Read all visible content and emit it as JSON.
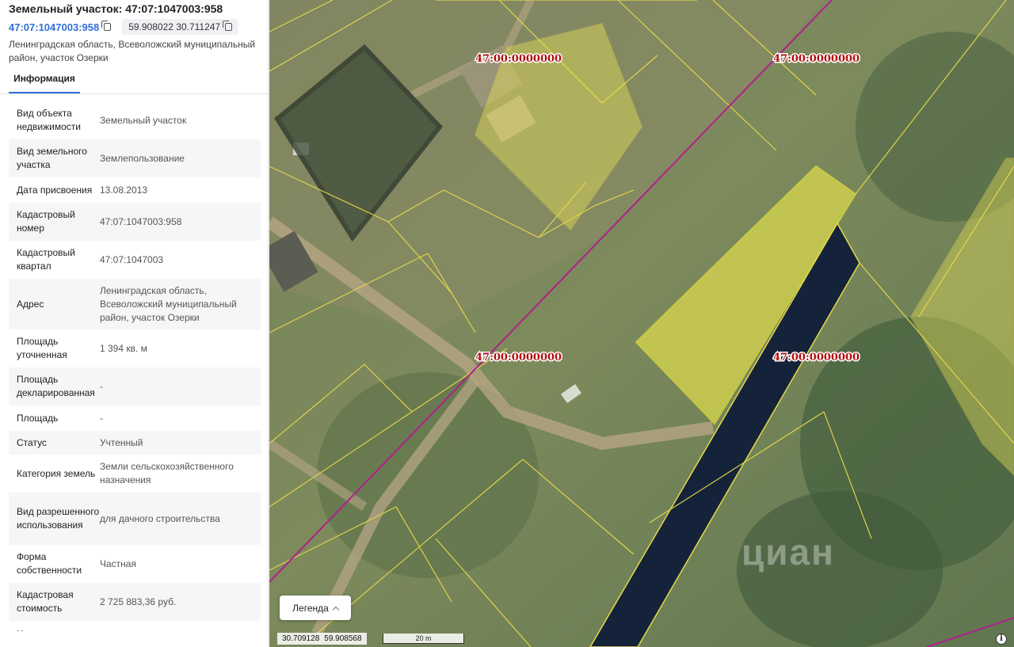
{
  "panel": {
    "title": "Земельный участок: 47:07:1047003:958",
    "cad_link": "47:07:1047003:958",
    "coords": "59.908022 30.711247",
    "address": "Ленинградская область, Всеволожский муниципальный район, участок Озерки",
    "tab": "Информация",
    "rows": [
      {
        "label": "Вид объекта недвижимости",
        "value": "Земельный участок"
      },
      {
        "label": "Вид земельного участка",
        "value": "Землепользование"
      },
      {
        "label": "Дата присвоения",
        "value": "13.08.2013"
      },
      {
        "label": "Кадастровый номер",
        "value": "47:07:1047003:958"
      },
      {
        "label": "Кадастровый квартал",
        "value": "47:07:1047003"
      },
      {
        "label": "Адрес",
        "value": "Ленинградская область, Всеволожский муниципальный район, участок Озерки"
      },
      {
        "label": "Площадь уточненная",
        "value": "1 394 кв. м"
      },
      {
        "label": "Площадь декларированная",
        "value": "-"
      },
      {
        "label": "Площадь",
        "value": "-"
      },
      {
        "label": "Статус",
        "value": "Учтенный"
      },
      {
        "label": "Категория земель",
        "value": "Земли сельскохозяйственного назначения"
      },
      {
        "label": "Вид разрешенного использования",
        "value": "для дачного строительства"
      },
      {
        "label": "Форма собственности",
        "value": "Частная"
      },
      {
        "label": "Кадастровая стоимость",
        "value": "2 725 883,36 руб."
      }
    ],
    "trailing": ". ."
  },
  "map": {
    "labels": [
      "47:00:0000000",
      "47:00:0000000",
      "47:00:0000000",
      "47:00:0000000"
    ],
    "legend": "Легенда",
    "coord_lon": "30.709128",
    "coord_lat": "59.908568",
    "scale": "20 m",
    "info": "i",
    "watermark": "циан",
    "colors": {
      "boundary": "#e6d84a",
      "quarter_line": "#b0208a",
      "parcel_fill": "#e6e05a",
      "label": "#b01010"
    }
  }
}
